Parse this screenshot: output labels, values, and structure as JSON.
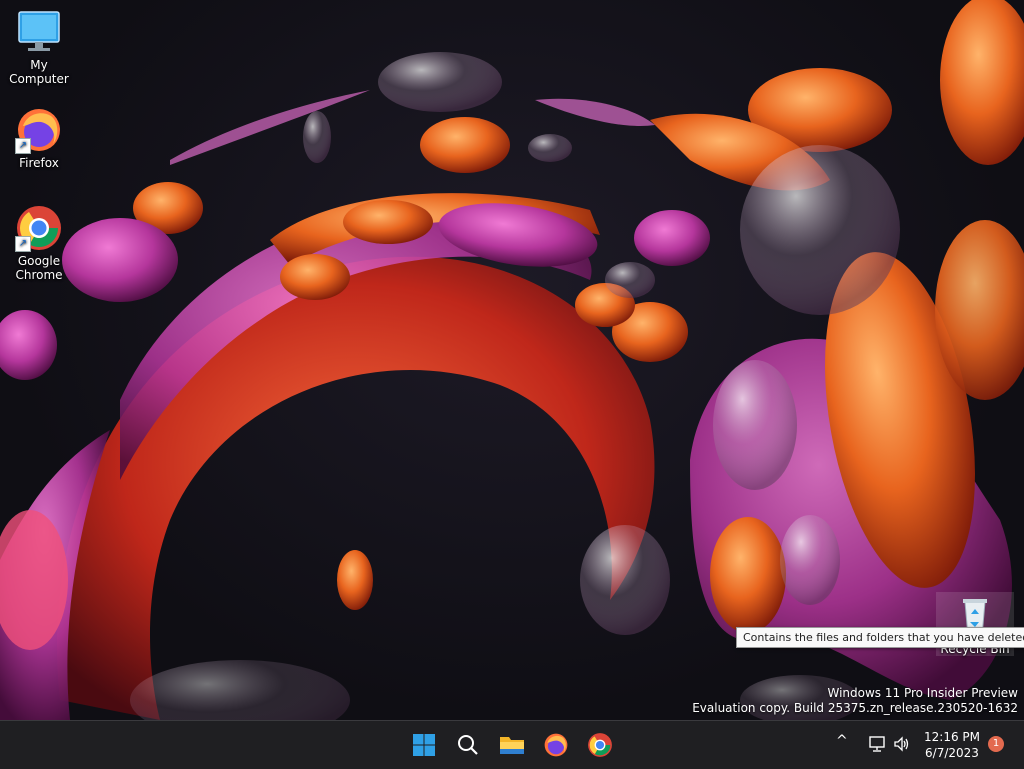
{
  "desktop": {
    "icons": [
      {
        "label": "My Computer",
        "icon": "monitor-icon",
        "shortcut": false
      },
      {
        "label": "Firefox",
        "icon": "firefox-icon",
        "shortcut": true
      },
      {
        "label": "Google Chrome",
        "icon": "chrome-icon",
        "shortcut": true
      },
      {
        "label": "Recycle Bin",
        "icon": "recycle-bin-icon",
        "shortcut": false
      }
    ],
    "tooltip": "Contains the files and folders that you have deleted.",
    "watermark": {
      "line1": "Windows 11 Pro Insider Preview",
      "line2": "Evaluation copy. Build 25375.zn_release.230520-1632"
    }
  },
  "taskbar": {
    "pinned": [
      {
        "name": "start",
        "icon": "windows-logo-icon"
      },
      {
        "name": "search",
        "icon": "search-icon"
      },
      {
        "name": "file-explorer",
        "icon": "folder-icon"
      },
      {
        "name": "firefox",
        "icon": "firefox-icon"
      },
      {
        "name": "chrome",
        "icon": "chrome-icon"
      }
    ],
    "tray": {
      "chevron": "^",
      "time": "12:16 PM",
      "date": "6/7/2023",
      "notifications": "1"
    }
  },
  "colors": {
    "taskbar_bg": "#1f1f22",
    "accent_blue": "#2fa0e6",
    "wallpaper_orange": "#e8641e",
    "wallpaper_magenta": "#b5369c"
  }
}
